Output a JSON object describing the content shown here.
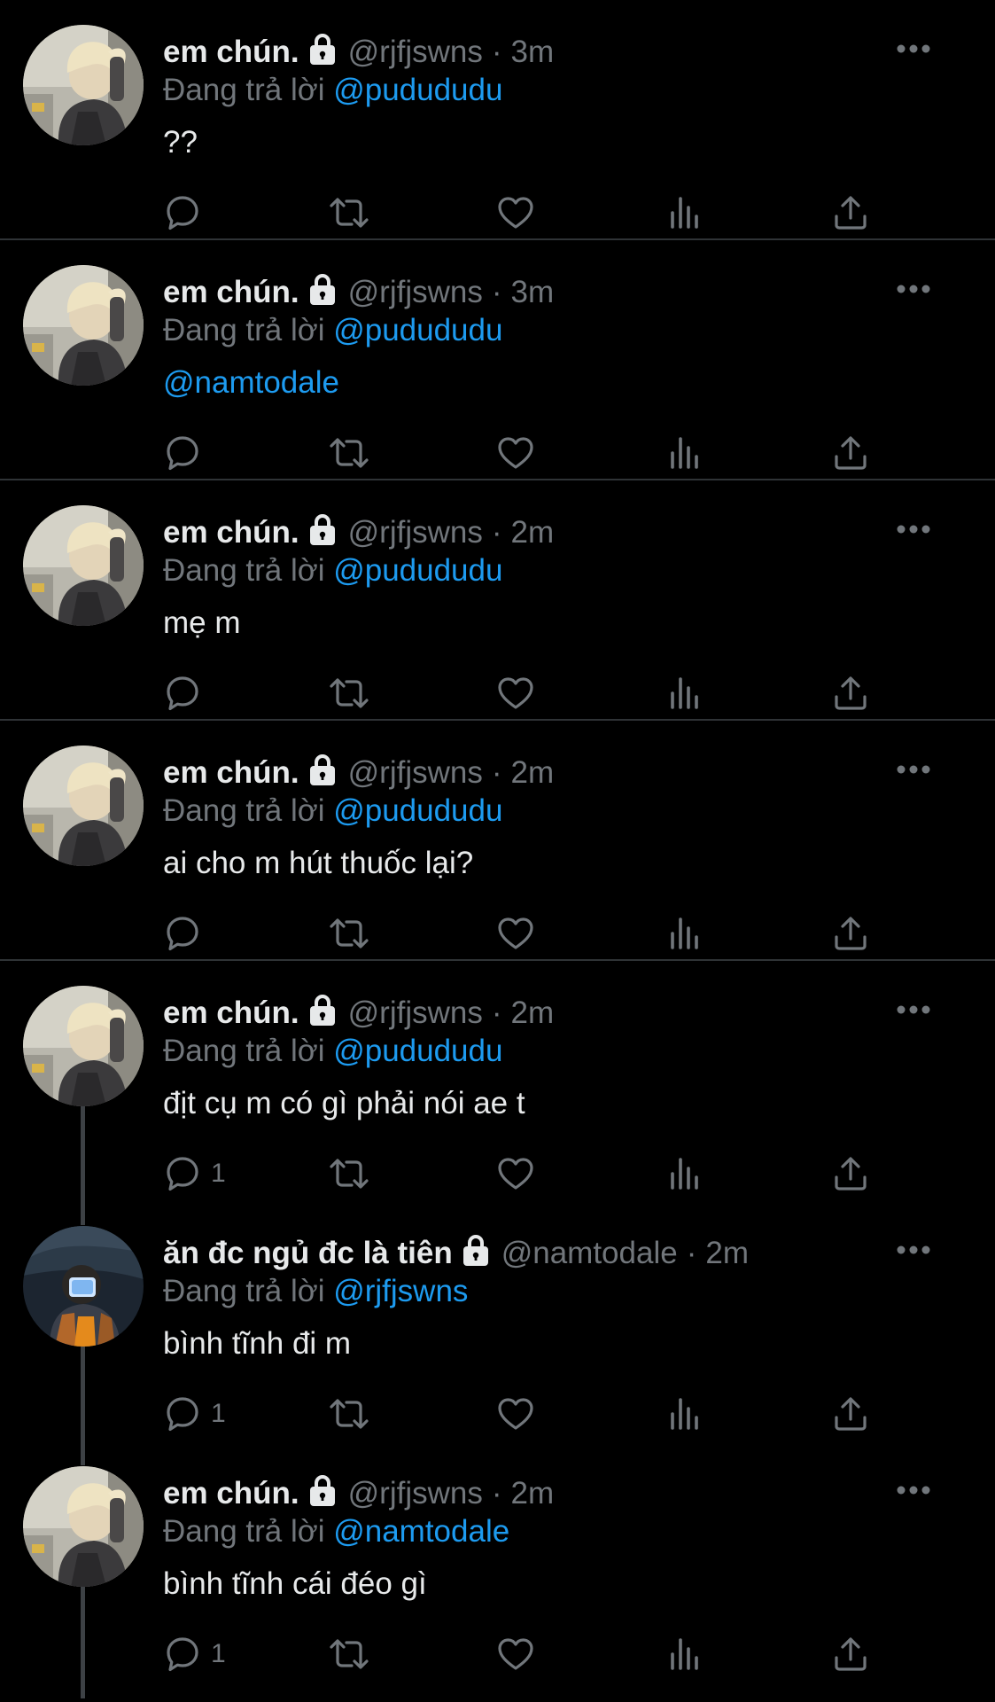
{
  "labels": {
    "replying_to": "Đang trả lời"
  },
  "tweets": [
    {
      "display_name": "em chún.",
      "handle": "@rjfjswns",
      "separator": "·",
      "time": "3m",
      "replying_to": "@pudududu",
      "text": "??",
      "reply_count": "",
      "avatar": "blonde-profile"
    },
    {
      "display_name": "em chún.",
      "handle": "@rjfjswns",
      "separator": "·",
      "time": "3m",
      "replying_to": "@pudududu",
      "text": "@namtodale",
      "reply_count": "",
      "avatar": "blonde-profile"
    },
    {
      "display_name": "em chún.",
      "handle": "@rjfjswns",
      "separator": "·",
      "time": "2m",
      "replying_to": "@pudududu",
      "text": "mẹ m",
      "reply_count": "",
      "avatar": "blonde-profile"
    },
    {
      "display_name": "em chún.",
      "handle": "@rjfjswns",
      "separator": "·",
      "time": "2m",
      "replying_to": "@pudududu",
      "text": "ai cho m hút thuốc lại?",
      "reply_count": "",
      "avatar": "blonde-profile"
    },
    {
      "display_name": "em chún.",
      "handle": "@rjfjswns",
      "separator": "·",
      "time": "2m",
      "replying_to": "@pudududu",
      "text": "địt cụ m có gì phải nói ae t",
      "reply_count": "1",
      "avatar": "blonde-profile"
    },
    {
      "display_name": "ăn đc ngủ đc là tiên",
      "handle": "@namtodale",
      "separator": "·",
      "time": "2m",
      "replying_to": "@rjfjswns",
      "text": "bình tĩnh đi m",
      "reply_count": "1",
      "avatar": "dark-photo-profile"
    },
    {
      "display_name": "em chún.",
      "handle": "@rjfjswns",
      "separator": "·",
      "time": "2m",
      "replying_to": "@namtodale",
      "text": "bình tĩnh cái đéo gì",
      "reply_count": "1",
      "avatar": "blonde-profile"
    }
  ],
  "icons": {
    "reply": "reply-icon",
    "retweet": "retweet-icon",
    "like": "like-icon",
    "views": "views-icon",
    "share": "share-icon",
    "more": "more-icon",
    "lock": "lock-icon"
  },
  "colors": {
    "background": "#000000",
    "text_primary": "#e7e9ea",
    "text_secondary": "#71767b",
    "accent": "#1d9bf0",
    "divider": "#2f3336"
  }
}
